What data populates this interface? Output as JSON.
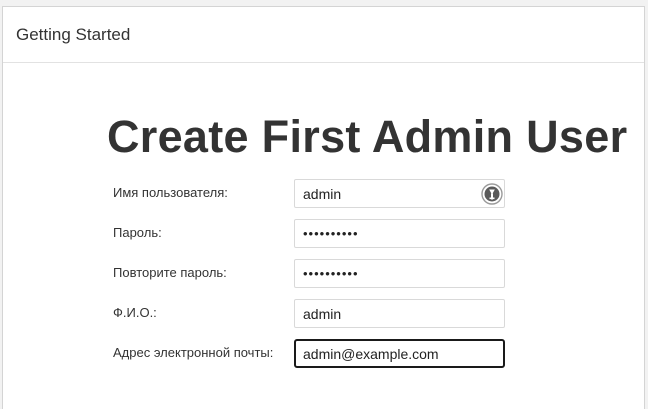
{
  "dialog": {
    "title": "Getting Started"
  },
  "heading": "Create First Admin User",
  "form": {
    "fields": [
      {
        "label": "Имя пользователя:",
        "value": "admin"
      },
      {
        "label": "Пароль:",
        "value": "••••••••••"
      },
      {
        "label": "Повторите пароль:",
        "value": "••••••••••"
      },
      {
        "label": "Ф.И.О.:",
        "value": "admin"
      },
      {
        "label": "Адрес электронной почты:",
        "value": "admin@example.com"
      }
    ]
  },
  "icons": {
    "autofill": "password-manager-icon"
  }
}
